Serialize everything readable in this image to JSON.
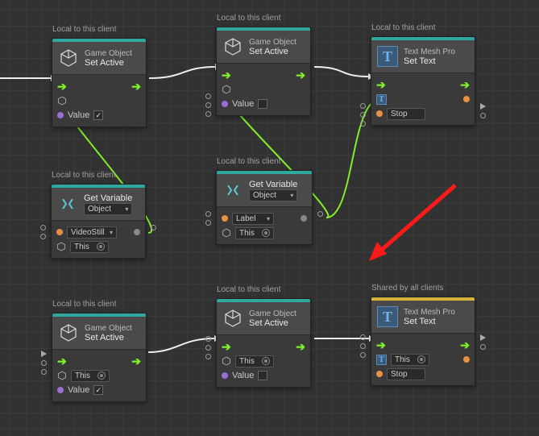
{
  "scope": {
    "local": "Local to this client",
    "shared": "Shared by all clients"
  },
  "nodes": {
    "n1": {
      "sub": "Game Object",
      "title": "Set Active",
      "value_label": "Value"
    },
    "n2": {
      "sub": "Game Object",
      "title": "Set Active",
      "value_label": "Value"
    },
    "n3": {
      "sub": "Text Mesh Pro",
      "title": "Set Text",
      "stop": "Stop"
    },
    "n4": {
      "title": "Get Variable",
      "kind": "Object",
      "field1": "VideoStill",
      "field2": "This"
    },
    "n5": {
      "title": "Get Variable",
      "kind": "Object",
      "field1": "Label",
      "field2": "This"
    },
    "n6": {
      "sub": "Game Object",
      "title": "Set Active",
      "value_label": "Value",
      "this": "This"
    },
    "n7": {
      "sub": "Game Object",
      "title": "Set Active",
      "value_label": "Value",
      "this": "This"
    },
    "n8": {
      "sub": "Text Mesh Pro",
      "title": "Set Text",
      "this": "This",
      "stop": "Stop"
    }
  }
}
